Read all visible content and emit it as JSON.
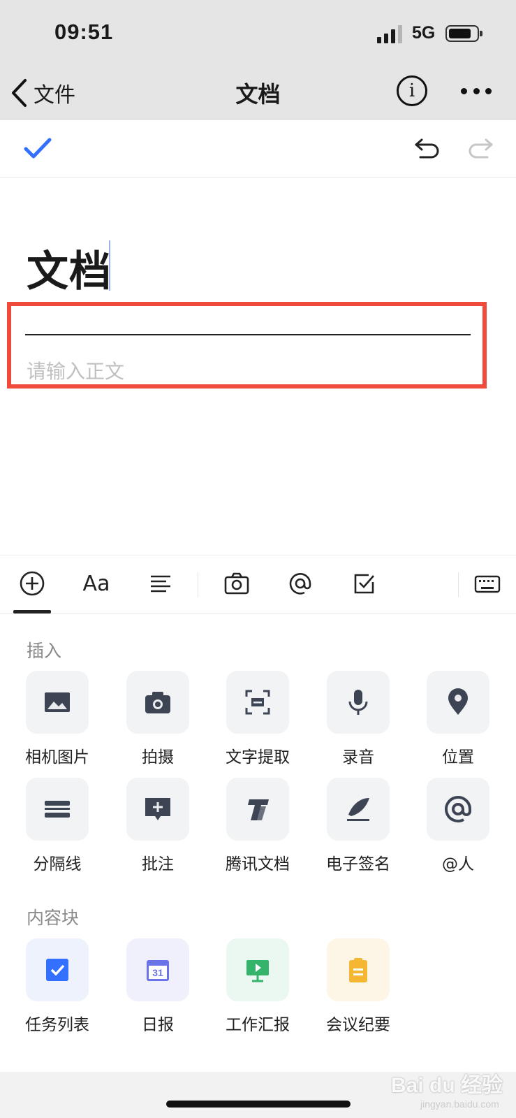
{
  "status_bar": {
    "time": "09:51",
    "network": "5G"
  },
  "nav": {
    "back_label": "文件",
    "title": "文档"
  },
  "document": {
    "title": "文档",
    "body_placeholder": "请输入正文"
  },
  "colors": {
    "accent": "#3370ff",
    "highlight": "#ef4a3c",
    "task": "#3370ff",
    "daily": "#6a74e8",
    "report": "#34b36b",
    "meeting": "#f5b731"
  },
  "format_toolbar": {
    "items": [
      "insert-plus-icon",
      "font-size-icon",
      "align-text-icon",
      "camera-icon",
      "at-mention-icon",
      "checkbox-icon",
      "keyboard-icon"
    ],
    "font_glyph": "Aa"
  },
  "insert_panel": {
    "section_label": "插入",
    "items": [
      {
        "label": "相机图片",
        "icon": "image-icon"
      },
      {
        "label": "拍摄",
        "icon": "camera-icon"
      },
      {
        "label": "文字提取",
        "icon": "text-scan-icon"
      },
      {
        "label": "录音",
        "icon": "microphone-icon"
      },
      {
        "label": "位置",
        "icon": "location-pin-icon"
      },
      {
        "label": "分隔线",
        "icon": "divider-icon"
      },
      {
        "label": "批注",
        "icon": "comment-icon"
      },
      {
        "label": "腾讯文档",
        "icon": "tencent-docs-icon"
      },
      {
        "label": "电子签名",
        "icon": "signature-pen-icon"
      },
      {
        "label": "@人",
        "icon": "at-icon"
      }
    ]
  },
  "content_blocks": {
    "section_label": "内容块",
    "items": [
      {
        "label": "任务列表",
        "icon": "task-list-icon"
      },
      {
        "label": "日报",
        "icon": "calendar-icon",
        "day": "31"
      },
      {
        "label": "工作汇报",
        "icon": "presentation-icon"
      },
      {
        "label": "会议纪要",
        "icon": "clipboard-icon"
      }
    ]
  },
  "watermark": {
    "text": "Bai du 经验",
    "url": "jingyan.baidu.com"
  }
}
